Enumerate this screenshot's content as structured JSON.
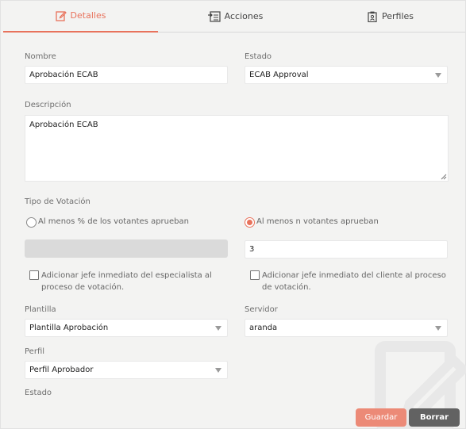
{
  "tabs": [
    {
      "label": "Detalles",
      "icon": "edit-icon",
      "active": true
    },
    {
      "label": "Acciones",
      "icon": "list-icon",
      "active": false
    },
    {
      "label": "Perfiles",
      "icon": "clipboard-user-icon",
      "active": false
    }
  ],
  "form": {
    "nombre": {
      "label": "Nombre",
      "value": "Aprobación ECAB"
    },
    "estado": {
      "label": "Estado",
      "value": "ECAB Approval"
    },
    "descripcion": {
      "label": "Descripción",
      "value": "Aprobación ECAB"
    },
    "tipo_votacion": {
      "label": "Tipo de Votación",
      "option_percent": "Al menos % de los votantes aprueban",
      "option_n": "Al menos n votantes aprueban",
      "selected": "option_n",
      "percent_value": "",
      "n_value": "3"
    },
    "checks": {
      "especialista": "Adicionar jefe inmediato del especialista al proceso de votación.",
      "cliente": "Adicionar jefe inmediato del cliente al proceso de votación."
    },
    "plantilla": {
      "label": "Plantilla",
      "value": "Plantilla Aprobación"
    },
    "servidor": {
      "label": "Servidor",
      "value": "aranda"
    },
    "perfil": {
      "label": "Perfil",
      "value": "Perfil Aprobador"
    },
    "estado_bottom": {
      "label": "Estado"
    }
  },
  "buttons": {
    "save": "Guardar",
    "delete": "Borrar"
  },
  "colors": {
    "accent": "#e8725c",
    "save_bg": "#ec8a77",
    "delete_bg": "#626262"
  }
}
